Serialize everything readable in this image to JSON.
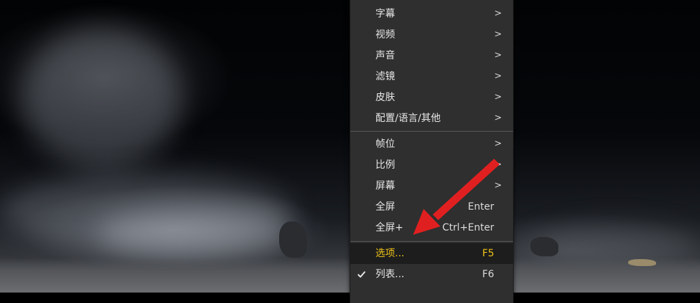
{
  "menu": {
    "items": [
      {
        "label": "字幕",
        "arrow": ">"
      },
      {
        "label": "视频",
        "arrow": ">"
      },
      {
        "label": "声音",
        "arrow": ">"
      },
      {
        "label": "滤镜",
        "arrow": ">"
      },
      {
        "label": "皮肤",
        "arrow": ">"
      },
      {
        "label": "配置/语言/其他",
        "arrow": ">"
      },
      {
        "label": "帧位",
        "arrow": ">"
      },
      {
        "label": "比例",
        "arrow": ">"
      },
      {
        "label": "屏幕",
        "arrow": ">"
      },
      {
        "label": "全屏",
        "shortcut": "Enter"
      },
      {
        "label": "全屏+",
        "shortcut": "Ctrl+Enter"
      },
      {
        "label": "选项...",
        "shortcut": "F5"
      },
      {
        "label": "列表...",
        "shortcut": "F6"
      }
    ],
    "highlight_color": "#f0c419",
    "check_icon": "checkmark-icon"
  },
  "annotation": {
    "arrow_color": "#e02020",
    "icon": "red-arrow"
  }
}
